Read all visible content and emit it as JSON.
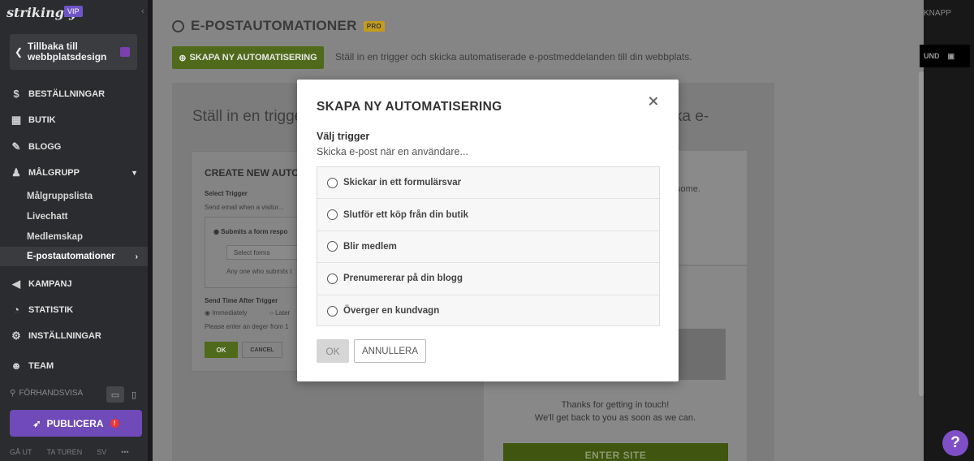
{
  "app": {
    "logo": "strikingly",
    "badge": "VIP"
  },
  "sidebar": {
    "back_label": "Tillbaka till webbplatsdesign",
    "items": [
      {
        "label": "BESTÄLLNINGAR",
        "icon": "dollar-circle-icon"
      },
      {
        "label": "BUTIK",
        "icon": "cart-icon"
      },
      {
        "label": "BLOGG",
        "icon": "pen-icon"
      },
      {
        "label": "MÅLGRUPP",
        "icon": "people-icon"
      },
      {
        "label": "KAMPANJ",
        "icon": "megaphone-icon"
      },
      {
        "label": "STATISTIK",
        "icon": "pie-chart-icon"
      },
      {
        "label": "INSTÄLLNINGAR",
        "icon": "gear-icon"
      },
      {
        "label": "TEAM",
        "icon": "team-icon"
      }
    ],
    "subitems": [
      "Målgruppslista",
      "Livechatt",
      "Medlemskap",
      "E-postautomationer"
    ],
    "preview_label": "FÖRHANDSVISA",
    "publish_label": "PUBLICERA",
    "bottom": [
      "GÅ UT",
      "TA TUREN",
      "SV",
      "•••"
    ]
  },
  "page": {
    "title": "E-POSTAUTOMATIONER",
    "pro_badge": "PRO",
    "new_button": "SKAPA NY AUTOMATISERING",
    "intro": "Ställ in en trigger och skicka automatiserade e-postmeddelanden till din webbplats.",
    "bg_heading_left": "Ställ in en trigger",
    "bg_heading_right": "ka e-",
    "bg_card": {
      "title": "CREATE NEW AUTOM",
      "select_trigger": "Select Trigger",
      "send_email": "Send email when a visitor...",
      "submits": "Submits a form respo",
      "select_forms": "Select forms",
      "anyone": "Any one who submits t",
      "send_time": "Send Time After Trigger",
      "immediately": "Immediately",
      "later": "Later",
      "hint": "Please enter an deger  from 1",
      "ok": "OK",
      "cancel": "CANCEL"
    },
    "right_text": "some.",
    "thanks_line1": "Thanks for getting in touch!",
    "thanks_line2": "We'll get back to you as soon as we can.",
    "enter_site": "ENTER SITE"
  },
  "right": {
    "btn1": "KNAPP",
    "btn2": "UND"
  },
  "modal": {
    "title": "SKAPA NY AUTOMATISERING",
    "choose_label": "Välj trigger",
    "sub_label": "Skicka e-post när en användare...",
    "options": [
      "Skickar in ett formulärsvar",
      "Slutför ett köp från din butik",
      "Blir medlem",
      "Prenumererar på din blogg",
      "Överger en kundvagn"
    ],
    "ok_label": "OK",
    "cancel_label": "ANNULLERA"
  },
  "help": "?"
}
